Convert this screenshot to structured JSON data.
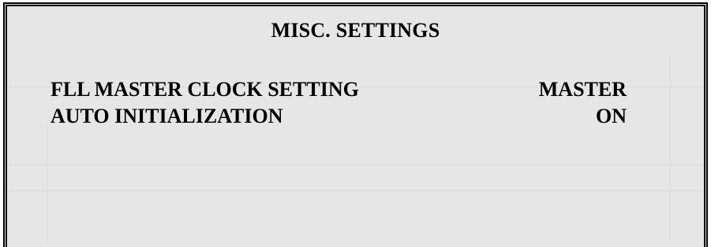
{
  "screen": {
    "title": "MISC. SETTINGS",
    "settings": [
      {
        "label": "FLL MASTER CLOCK SETTING",
        "value": "MASTER"
      },
      {
        "label": "AUTO INITIALIZATION",
        "value": "ON"
      }
    ]
  },
  "colors": {
    "background": "#e6e6e6",
    "border": "#000000",
    "text": "#000000"
  }
}
